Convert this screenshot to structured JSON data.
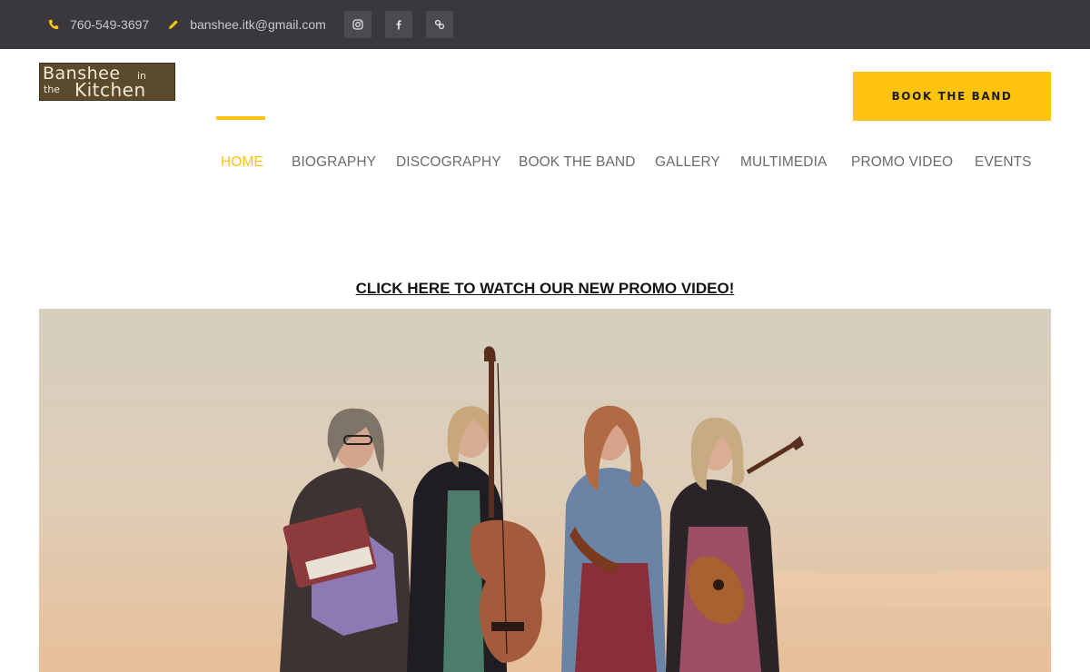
{
  "topbar": {
    "phone": "760-549-3697",
    "email": "banshee.itk@gmail.com",
    "phone_icon": "phone-icon",
    "email_icon": "pencil-icon",
    "social": [
      "instagram-icon",
      "facebook-icon",
      "link-icon"
    ]
  },
  "logo": {
    "line1": "Banshee",
    "line1_small": "in",
    "line2_small": "the",
    "line2": "Kitchen"
  },
  "header": {
    "book_button": "BOOK THE BAND"
  },
  "nav": {
    "items": [
      {
        "label": "HOME",
        "active": true
      },
      {
        "label": "BIOGRAPHY",
        "active": false
      },
      {
        "label": "DISCOGRAPHY",
        "active": false
      },
      {
        "label": "BOOK THE BAND",
        "active": false
      },
      {
        "label": "GALLERY",
        "active": false
      },
      {
        "label": "MULTIMEDIA",
        "active": false
      },
      {
        "label": "PROMO VIDEO",
        "active": false
      },
      {
        "label": "EVENTS",
        "active": false
      }
    ]
  },
  "main": {
    "promo_link": "CLICK HERE TO WATCH OUR NEW PROMO VIDEO!"
  },
  "colors": {
    "accent": "#fec30c",
    "topbar_bg": "#3a383d",
    "nav_text": "#6b6b6b"
  }
}
